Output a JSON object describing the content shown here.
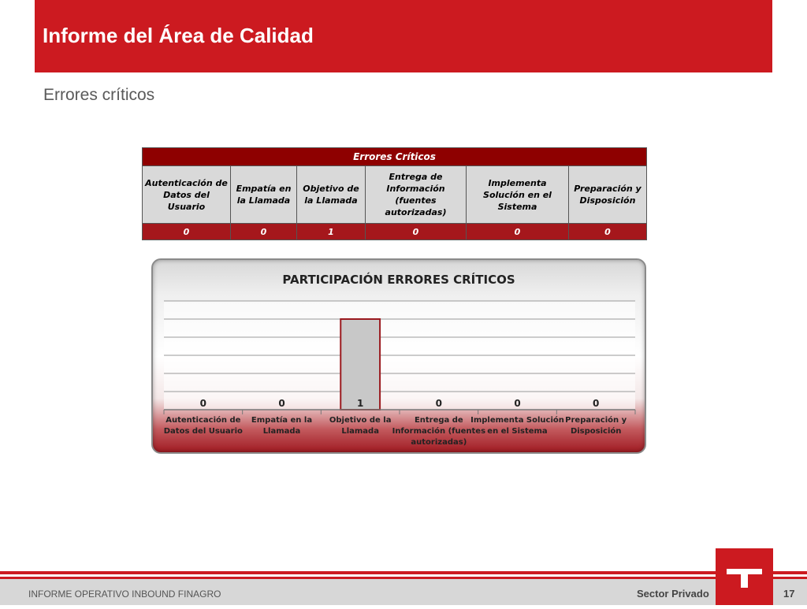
{
  "header": {
    "title": "Informe del Área de Calidad"
  },
  "subtitle": "Errores críticos",
  "table": {
    "title": "Errores Críticos",
    "columns": [
      "Autenticación de Datos del Usuario",
      "Empatía en la Llamada",
      "Objetivo de la Llamada",
      "Entrega de Información (fuentes autorizadas)",
      "Implementa Solución en el Sistema",
      "Preparación y Disposición"
    ],
    "values": [
      "0",
      "0",
      "1",
      "0",
      "0",
      "0"
    ]
  },
  "chart_data": {
    "type": "bar",
    "title": "PARTICIPACIÓN ERRORES CRÍTICOS",
    "categories": [
      "Autenticación de Datos del Usuario",
      "Empatía en la Llamada",
      "Objetivo de la Llamada",
      "Entrega de Información (fuentes autorizadas)",
      "Implementa Solución en el Sistema",
      "Preparación y Disposición"
    ],
    "values": [
      0,
      0,
      1,
      0,
      0,
      0
    ],
    "data_labels": [
      "0",
      "0",
      "1",
      "0",
      "0",
      "0"
    ],
    "ylim": [
      0,
      1.2
    ],
    "grid": true,
    "xlabel": "",
    "ylabel": ""
  },
  "footer": {
    "left": "INFORME OPERATIVO INBOUND FINAGRO",
    "right": "Sector Privado",
    "page": "17"
  },
  "colors": {
    "brand_red": "#cc1a20",
    "table_dark_red": "#8e0000",
    "bar_gray": "#c8c8c8"
  },
  "icons": {
    "logo": "company-logo-icon"
  }
}
